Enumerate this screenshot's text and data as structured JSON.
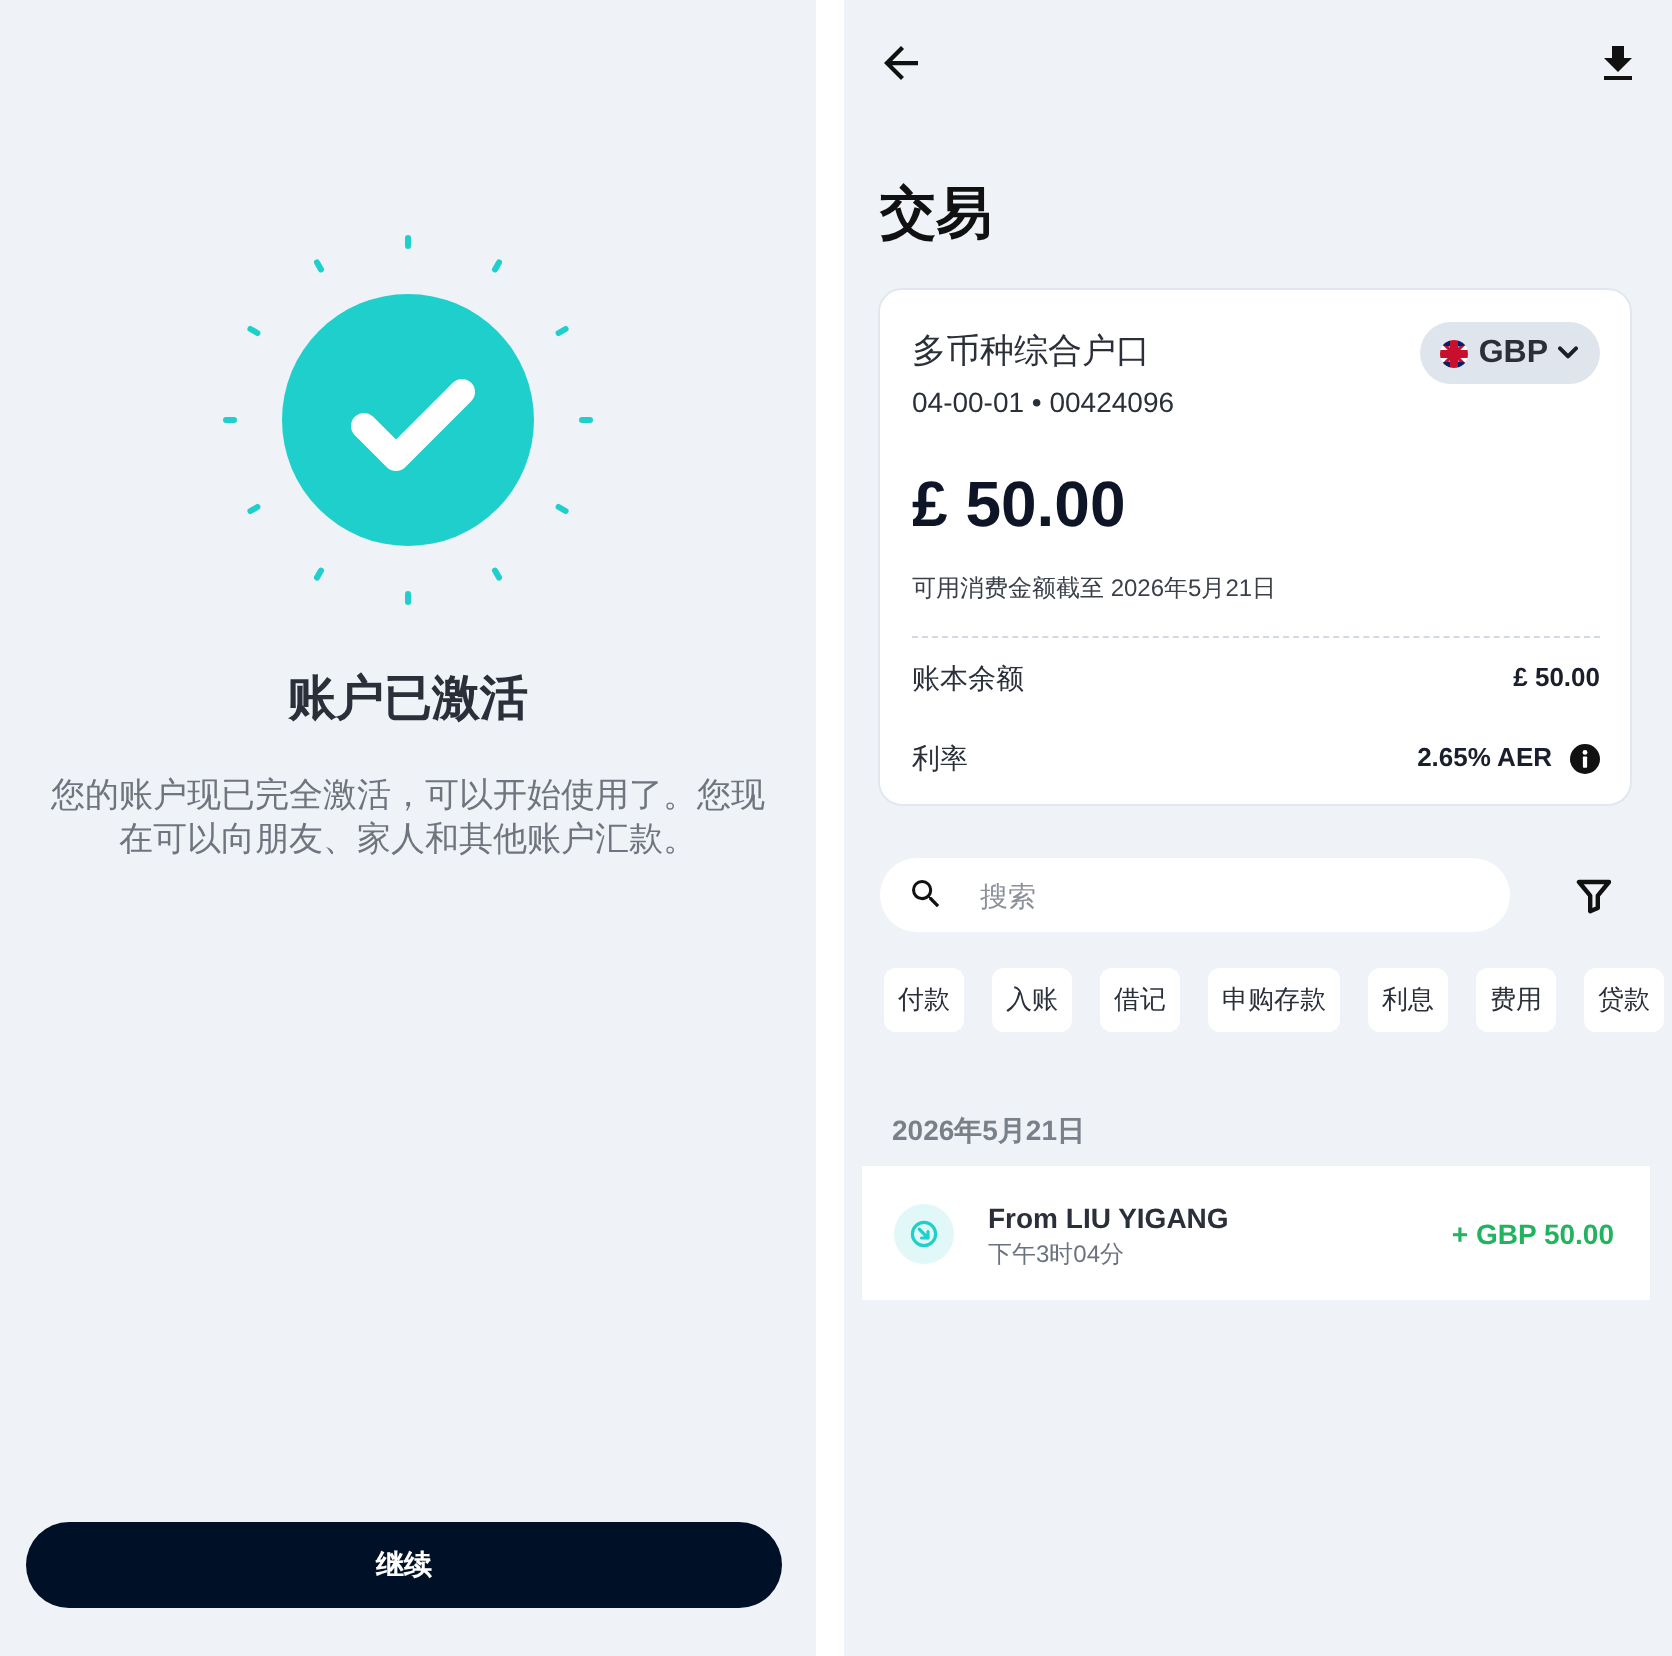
{
  "activation_screen": {
    "title": "账户已激活",
    "message": "您的账户现已完全激活，可以开始使用了。您现在可以向朋友、家人和其他账户汇款。",
    "continue_button": "继续"
  },
  "transactions_screen": {
    "title": "交易",
    "account_card": {
      "name": "多币种综合户口",
      "account_number": "04-00-01 • 00424096",
      "currency": "GBP",
      "balance": "£ 50.00",
      "available_note": "可用消费金额截至 2026年5月21日",
      "rows": [
        {
          "label": "账本余额",
          "value": "£ 50.00",
          "info": false
        },
        {
          "label": "利率",
          "value": "2.65% AER",
          "info": true
        }
      ]
    },
    "search": {
      "placeholder": "搜索"
    },
    "filter_chips": [
      "付款",
      "入账",
      "借记",
      "申购存款",
      "利息",
      "费用",
      "贷款"
    ],
    "groups": [
      {
        "date": "2026年5月21日",
        "transactions": [
          {
            "name": "From LIU YIGANG",
            "time": "下午3时04分",
            "amount": "+ GBP 50.00",
            "kind": "incoming"
          }
        ]
      }
    ]
  }
}
